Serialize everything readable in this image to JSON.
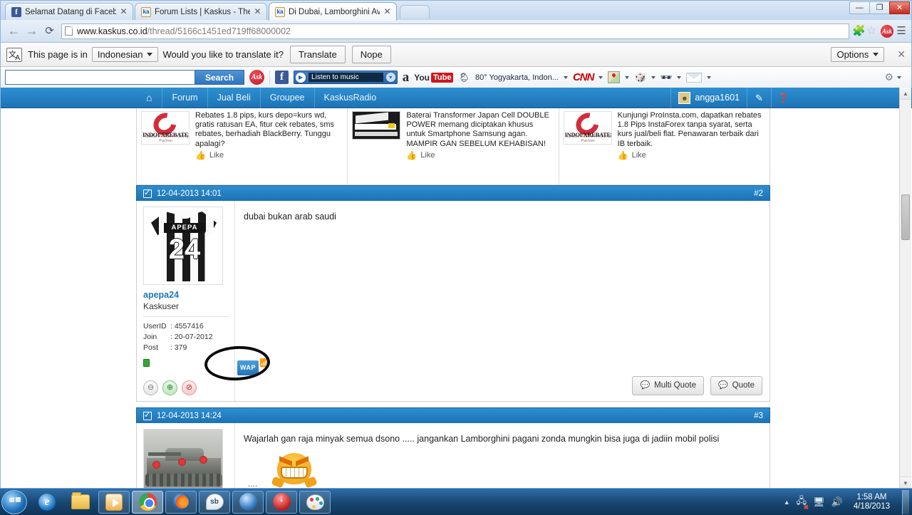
{
  "browser": {
    "tabs": [
      {
        "title": "Selamat Datang di Facebo",
        "favicon": "facebook-icon",
        "active": false
      },
      {
        "title": "Forum Lists | Kaskus - The",
        "favicon": "kaskus-icon",
        "active": false
      },
      {
        "title": "Di Dubai, Lamborghini Av",
        "favicon": "kaskus-icon",
        "active": true
      }
    ],
    "window_controls": {
      "minimize": "—",
      "maximize": "❐",
      "close": "✕"
    },
    "nav": {
      "back": "←",
      "forward": "→",
      "reload": "⟳"
    },
    "url_host": "www.kaskus.co.id",
    "url_path": "/thread/5166c1451ed719ff68000002",
    "omni_icons": [
      "puzzle-icon",
      "star-icon",
      "ask-icon",
      "menu-icon"
    ]
  },
  "translate_bar": {
    "prefix": "This page is in",
    "language": "Indonesian",
    "question": "Would you like to translate it?",
    "translate_label": "Translate",
    "nope_label": "Nope",
    "options_label": "Options",
    "close_label": "✕"
  },
  "ask_toolbar": {
    "search_placeholder": "",
    "search_value": "",
    "search_button": "Search",
    "ask_label": "Ask",
    "facebook_label": "f",
    "music_label": "Listen to music",
    "amazon_label": "a",
    "youtube_you": "You",
    "youtube_tube": "Tube",
    "weather": "80° Yogyakarta, Indon...",
    "cnn_label": "CNN",
    "items": [
      "maps-icon",
      "dice-icon",
      "opera-icon",
      "mail-icon"
    ],
    "settings": "gear-icon"
  },
  "kaskus_nav": {
    "home_icon": "home-icon",
    "items": [
      "Forum",
      "Jual Beli",
      "Groupee",
      "KaskusRadio"
    ],
    "username": "angga1601",
    "compose_icon": "pencil-icon",
    "help_icon": "help-icon"
  },
  "ads": [
    {
      "brand": "INDOFXREBATES",
      "brand_sub": "Kaskus Rebates Trading Partner",
      "text": "Rebates 1.8 pips, kurs depo=kurs wd, gratis ratusan EA, fitur cek rebates, sms rebates, berhadiah BlackBerry. Tunggu apalagi?",
      "like": "Like"
    },
    {
      "brand": "",
      "brand_sub": "",
      "text": "Baterai Transformer Japan Cell DOUBLE POWER memang diciptakan khusus untuk Smartphone Samsung agan. MAMPIR GAN SEBELUM KEHABISAN!",
      "like": "Like"
    },
    {
      "brand": "INDOFXREBATES",
      "brand_sub": "Kaskus Rebates Trading Partner",
      "text": "Kunjungi ProInsta.com, dapatkan rebates 1.8 Pips InstaForex tanpa syarat, serta kurs jual/beli flat. Penawaran terbaik dari IB terbaik.",
      "like": "Like"
    }
  ],
  "posts": [
    {
      "timestamp": "12-04-2013 14:01",
      "number": "#2",
      "user": {
        "name": "apepa24",
        "title": "Kaskuser",
        "avatar_type": "jersey-avatar",
        "jersey_name": "APEPA",
        "jersey_number": "24",
        "stats": [
          {
            "key": "UserID",
            "sep": ":",
            "value": "4557416"
          },
          {
            "key": "Join",
            "sep": ":",
            "value": "20-07-2012"
          },
          {
            "key": "Post",
            "sep": ":",
            "value": "379"
          }
        ],
        "badges": [
          "minus-icon",
          "plus-reputation-icon",
          "report-icon"
        ]
      },
      "body": "dubai bukan arab saudi",
      "wap_badge": "WAP",
      "annotated": true,
      "actions": [
        {
          "label": "Multi Quote",
          "icon": "multi-quote-icon"
        },
        {
          "label": "Quote",
          "icon": "quote-icon"
        }
      ]
    },
    {
      "timestamp": "12-04-2013 14:24",
      "number": "#3",
      "user": {
        "name": "",
        "title": "",
        "avatar_type": "tank-avatar",
        "jersey_name": "",
        "jersey_number": "",
        "stats": [],
        "badges": []
      },
      "body": "Wajarlah gan raja minyak semua dsono ..... jangankan Lamborghini pagani zonda mungkin bisa juga di jadiin mobil polisi",
      "body_trailing": "....",
      "emoticon": "grin-emoticon",
      "wap_badge": "",
      "annotated": false,
      "actions": []
    }
  ],
  "taskbar": {
    "start_label": "start-orb",
    "items": [
      "internet-explorer-icon",
      "windows-explorer-icon",
      "media-player-icon",
      "google-chrome-icon",
      "firefox-icon",
      "sb-messenger-icon",
      "blue-app-icon",
      "idm-downloader-icon",
      "paint-icon"
    ],
    "tray": [
      "show-hidden-icon",
      "network-icon",
      "display-icon",
      "volume-icon"
    ],
    "time": "1:58 AM",
    "date": "4/18/2013"
  }
}
